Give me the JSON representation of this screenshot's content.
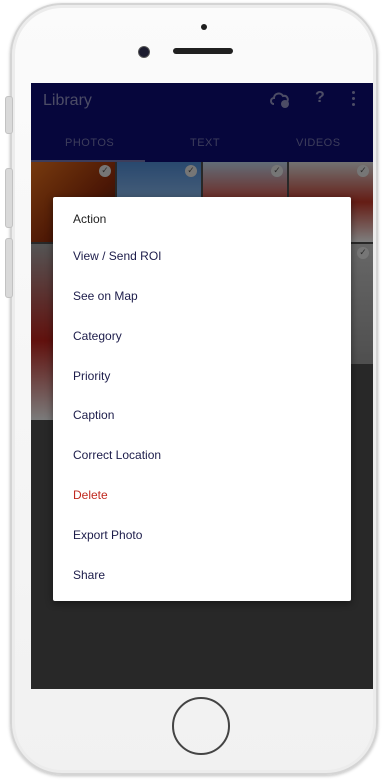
{
  "app": {
    "title": "Library",
    "tabs": [
      {
        "label": "PHOTOS",
        "active": true
      },
      {
        "label": "TEXT",
        "active": false
      },
      {
        "label": "VIDEOS",
        "active": false
      }
    ],
    "icons": {
      "cloud": "cloud-sync-icon",
      "help": "help-icon",
      "more": "more-vert-icon"
    },
    "help_glyph": "?"
  },
  "dialog": {
    "title": "Action",
    "items": [
      {
        "label": "View / Send ROI"
      },
      {
        "label": "See on Map"
      },
      {
        "label": "Category"
      },
      {
        "label": "Priority"
      },
      {
        "label": "Caption"
      },
      {
        "label": "Correct Location"
      },
      {
        "label": "Delete",
        "danger": true
      },
      {
        "label": "Export Photo"
      },
      {
        "label": "Share"
      }
    ]
  },
  "colors": {
    "appbar": "#0b0b6e",
    "danger": "#c0281e",
    "menu_text": "#1c1c4a"
  }
}
